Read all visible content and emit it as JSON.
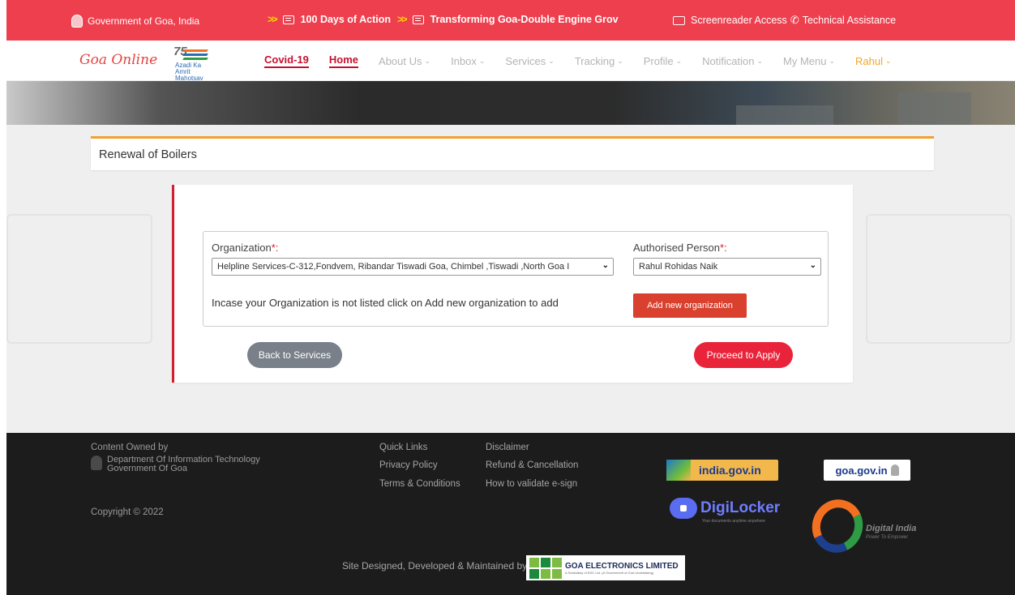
{
  "topbar": {
    "gov_label": "Government of Goa, India",
    "ticker_1": "100 Days of Action",
    "ticker_2": "Transforming Goa-Double Engine Grov",
    "screenreader": "Screenreader Access",
    "technical": "Technical Assistance"
  },
  "nav": {
    "logo": "Goa Online",
    "azadi_75": "75",
    "azadi_text": "Azadi Ka Amrit Mahotsav",
    "items": [
      {
        "label": "Covid-19"
      },
      {
        "label": "Home"
      },
      {
        "label": "About Us"
      },
      {
        "label": "Inbox"
      },
      {
        "label": "Services"
      },
      {
        "label": "Tracking"
      },
      {
        "label": "Profile"
      },
      {
        "label": "Notification"
      },
      {
        "label": "My Menu"
      },
      {
        "label": "Rahul"
      }
    ]
  },
  "page": {
    "title": "Renewal of Boilers"
  },
  "form": {
    "organization_label": "Organization",
    "organization_value": "Helpline Services-C-312,Fondvem, Ribandar Tiswadi Goa, Chimbel ,Tiswadi ,North Goa I",
    "authorised_label": "Authorised Person",
    "authorised_value": "Rahul Rohidas Naik",
    "required_mark": "*:",
    "note": "Incase your Organization is not listed click on Add new organization to add",
    "add_org_button": "Add new organization",
    "back_button": "Back to Services",
    "proceed_button": "Proceed to Apply"
  },
  "footer": {
    "owned_by": "Content Owned by",
    "dept_line1": "Department Of Information Technology",
    "dept_line2": "Government Of Goa",
    "copyright": "Copyright © 2022",
    "quick_links": "Quick Links",
    "privacy": "Privacy Policy",
    "terms": "Terms & Conditions",
    "disclaimer": "Disclaimer",
    "refund": "Refund & Cancellation",
    "validate": "How to validate e-sign",
    "india_gov": "india.gov.in",
    "goa_gov": "goa.gov.in",
    "digilocker": "DigiLocker",
    "digilocker_tag": "Your documents anytime anywhere",
    "digital_india": "Digital India",
    "digital_india_tag": "Power To Empower",
    "site_designed": "Site Designed, Developed & Maintained by",
    "gel_name": "GOA ELECTRONICS LIMITED",
    "gel_tag": "A Subsidiary of EDC Ltd. (A Government of Goa Undertaking)"
  },
  "colors": {
    "topbar": "#ee3f4e",
    "accent_red": "#d21f2f",
    "proceed": "#e9243a",
    "back": "#7a8089",
    "title_border": "#f0a030",
    "user": "#f5a623"
  },
  "icons": [
    "goa-emblem-icon",
    "double-chevron-icon",
    "news-icon",
    "monitor-icon",
    "phone-icon",
    "chevron-down-icon"
  ]
}
